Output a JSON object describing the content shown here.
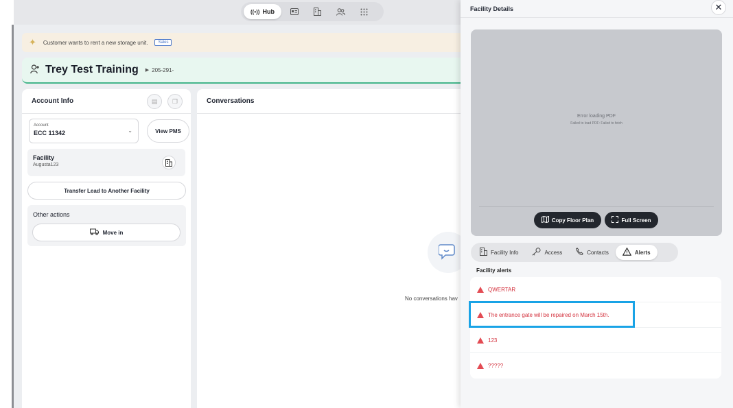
{
  "nav": {
    "hub_label": "Hub"
  },
  "banner": {
    "text": "Customer wants to rent a new storage unit.",
    "tag": "Sales"
  },
  "customer": {
    "name": "Trey Test Training",
    "phone": "205-291-"
  },
  "account_panel": {
    "title": "Account Info",
    "account_label": "Account",
    "account_value": "ECC 11342",
    "view_pms": "View PMS",
    "facility_label": "Facility",
    "facility_value": "Augusta123",
    "transfer_button": "Transfer Lead to Another Facility",
    "other_actions": "Other actions",
    "move_in": "Move in"
  },
  "conversations": {
    "title": "Conversations",
    "empty_text": "No conversations hav"
  },
  "drawer": {
    "title": "Facility Details",
    "pdf_error_title": "Error loading PDF",
    "pdf_error_detail": "Failed to load PDF: Failed to fetch",
    "copy_floor_plan": "Copy Floor Plan",
    "full_screen": "Full Screen",
    "tabs": [
      {
        "label": "Facility Info"
      },
      {
        "label": "Access"
      },
      {
        "label": "Contacts"
      },
      {
        "label": "Alerts"
      }
    ],
    "alerts_title": "Facility alerts",
    "alerts": [
      {
        "text": "QWERTAR"
      },
      {
        "text": "The entrance gate will be repaired on March 15th."
      },
      {
        "text": "123"
      },
      {
        "text": "?????"
      }
    ]
  },
  "colors": {
    "accent_green": "#43b58a",
    "alert_red": "#d3303c",
    "highlight_blue": "#19a3e6",
    "dark_button": "#23272e"
  }
}
